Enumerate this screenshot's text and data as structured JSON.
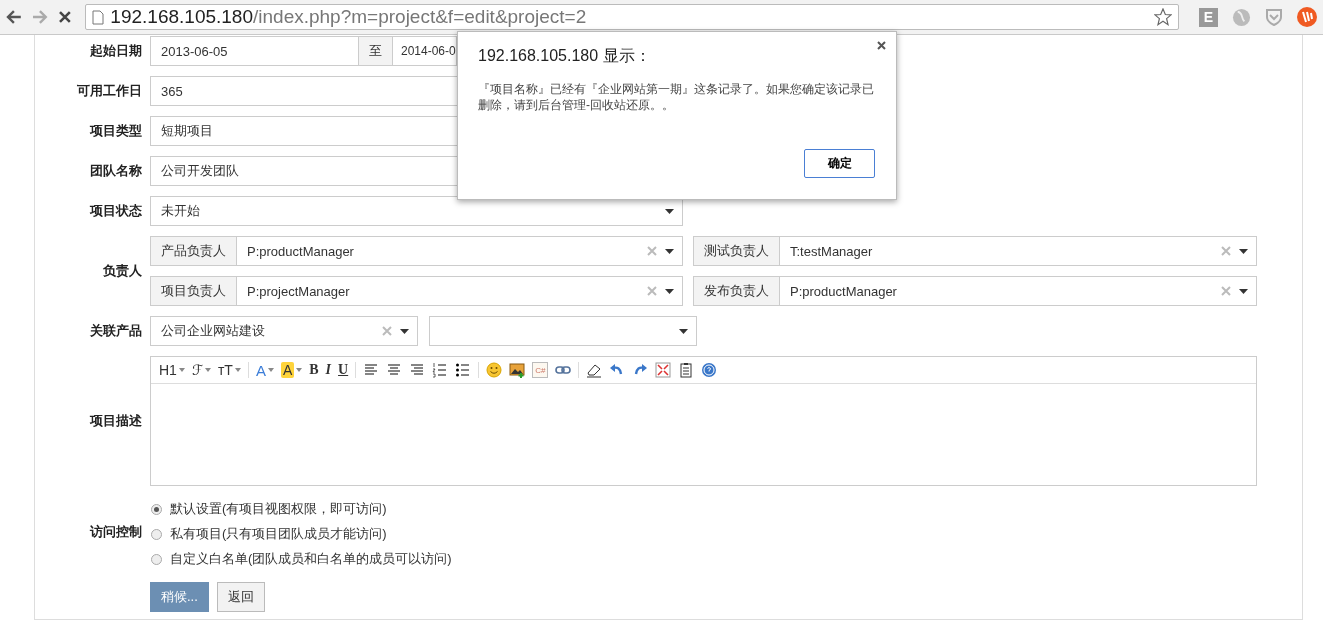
{
  "browser": {
    "url_host": "192.168.105.180",
    "url_path": "/index.php?m=project&f=edit&project=2",
    "extension_label": "E"
  },
  "form": {
    "dates": {
      "label": "起始日期",
      "start": "2013-06-05",
      "separator": "至",
      "end": "2014-06-0"
    },
    "workdays": {
      "label": "可用工作日",
      "value": "365"
    },
    "type": {
      "label": "项目类型",
      "value": "短期项目"
    },
    "team": {
      "label": "团队名称",
      "value": "公司开发团队"
    },
    "status": {
      "label": "项目状态",
      "value": "未开始"
    },
    "owners": {
      "label": "负责人",
      "items": [
        {
          "label": "产品负责人",
          "value": "P:productManager"
        },
        {
          "label": "测试负责人",
          "value": "T:testManager"
        },
        {
          "label": "项目负责人",
          "value": "P:projectManager"
        },
        {
          "label": "发布负责人",
          "value": "P:productManager"
        }
      ]
    },
    "products": {
      "label": "关联产品",
      "items": [
        {
          "value": "公司企业网站建设"
        },
        {
          "value": ""
        }
      ]
    },
    "description": {
      "label": "项目描述",
      "tools": [
        {
          "kind": "menu",
          "label": "H1"
        },
        {
          "kind": "menu",
          "label": "ℱ"
        },
        {
          "kind": "menu",
          "label": "ᴛT"
        },
        {
          "kind": "sep"
        },
        {
          "kind": "fontcolor",
          "label": "A"
        },
        {
          "kind": "highlight",
          "label": "A"
        },
        {
          "kind": "bold",
          "label": "B"
        },
        {
          "kind": "italic",
          "label": "I"
        },
        {
          "kind": "underline",
          "label": "U"
        },
        {
          "kind": "sep"
        },
        {
          "kind": "align-left"
        },
        {
          "kind": "align-center"
        },
        {
          "kind": "align-right"
        },
        {
          "kind": "ordered-list"
        },
        {
          "kind": "bullet-list"
        },
        {
          "kind": "sep"
        },
        {
          "kind": "emoji"
        },
        {
          "kind": "image"
        },
        {
          "kind": "code",
          "label": "C#"
        },
        {
          "kind": "link"
        },
        {
          "kind": "sep"
        },
        {
          "kind": "eraser"
        },
        {
          "kind": "undo"
        },
        {
          "kind": "redo"
        },
        {
          "kind": "fullscreen"
        },
        {
          "kind": "paste"
        },
        {
          "kind": "help"
        }
      ]
    },
    "access": {
      "label": "访问控制",
      "options": [
        {
          "label": "默认设置(有项目视图权限，即可访问)",
          "selected": true
        },
        {
          "label": "私有项目(只有项目团队成员才能访问)",
          "selected": false
        },
        {
          "label": "自定义白名单(团队成员和白名单的成员可以访问)",
          "selected": false
        }
      ]
    },
    "buttons": [
      {
        "kind": "primary",
        "label": "稍候..."
      },
      {
        "kind": "default",
        "label": "返回"
      }
    ]
  },
  "dialog": {
    "title": "192.168.105.180 显示：",
    "message": "『项目名称』已经有『企业网站第一期』这条记录了。如果您确定该记录已删除，请到后台管理-回收站还原。。",
    "button": "确定"
  }
}
